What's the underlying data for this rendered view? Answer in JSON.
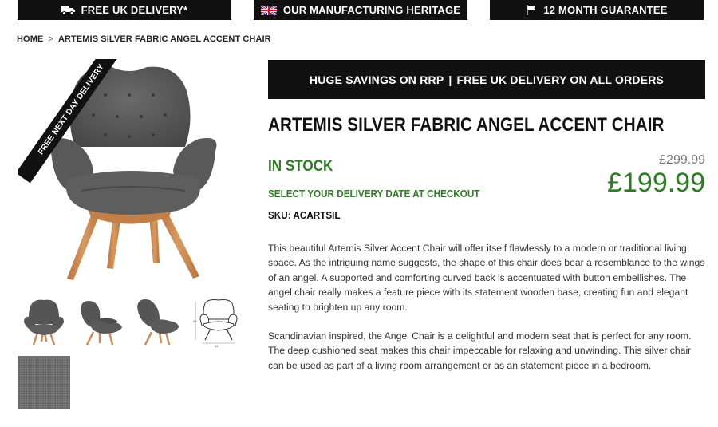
{
  "topbar": {
    "delivery_label": "FREE UK DELIVERY*",
    "heritage_label": "OUR MANUFACTURING HERITAGE",
    "guarantee_label": "12 MONTH GUARANTEE",
    "icons": [
      "truck-icon",
      "uk-flag-icon",
      "flag-icon"
    ]
  },
  "breadcrumb": {
    "home": "HOME",
    "separator": ">",
    "current": "ARTEMIS SILVER FABRIC ANGEL ACCENT CHAIR"
  },
  "gallery": {
    "ribbon_text": "FREE NEXT DAY DELIVERY",
    "thumbnails": [
      "front view",
      "side view",
      "back view",
      "dimensions drawing",
      "fabric swatch"
    ]
  },
  "promo": {
    "part1": "HUGE SAVINGS ON RRP",
    "divider": "|",
    "part2": "FREE UK DELIVERY ON ALL ORDERS"
  },
  "product": {
    "title": "ARTEMIS SILVER FABRIC ANGEL ACCENT CHAIR",
    "stock": "IN STOCK",
    "delivery_note": "SELECT YOUR DELIVERY DATE AT CHECKOUT",
    "sku": "SKU: ACARTSIL",
    "old_price": "£299.99",
    "price": "£199.99",
    "description": [
      "This beautiful Artemis Silver Accent Chair will offer itself flawlessly to a modern or traditional living space. As the intriguing name suggests, the shape of this chair does bear a resemblance to the wings of an angel. A supported and comforting curved back is accentuated with button embellishes. The angel chair really makes a feature piece with its statement wooden base, creating fun and elegant seating to brighten up any room.",
      "Scandinavian inspired, the Angel Chair is a delightful and modern seat that is perfect for any room. The deep cushioned seat makes this chair impeccable for relaxing and unwinding. This silver chair can be used as part of a living room arrangement or as an statement piece in a bedroom."
    ]
  },
  "colors": {
    "bar_bg": "#111111",
    "green": "#2e7d24",
    "fabric": "#5b5b5b",
    "wood": "#c98a55"
  }
}
